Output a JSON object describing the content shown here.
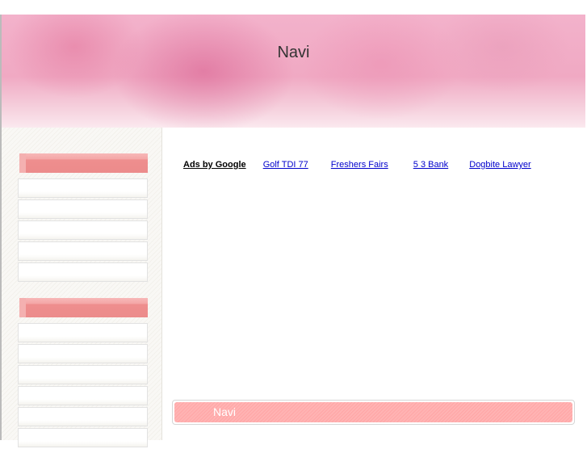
{
  "header": {
    "title": "Navi"
  },
  "sidebar": {
    "groups": [
      {
        "items": [
          "",
          "",
          "",
          "",
          ""
        ]
      },
      {
        "items": [
          "",
          "",
          "",
          "",
          "",
          ""
        ]
      }
    ]
  },
  "ads": {
    "label": "Ads by Google",
    "links": [
      "Golf TDI 77",
      "Freshers Fairs",
      "5 3 Bank",
      "Dogbite Lawyer"
    ]
  },
  "footer": {
    "title": "Navi"
  },
  "colors": {
    "accent": "#ee8e8e",
    "footer": "#ffa6a6",
    "link": "#0000cc"
  }
}
